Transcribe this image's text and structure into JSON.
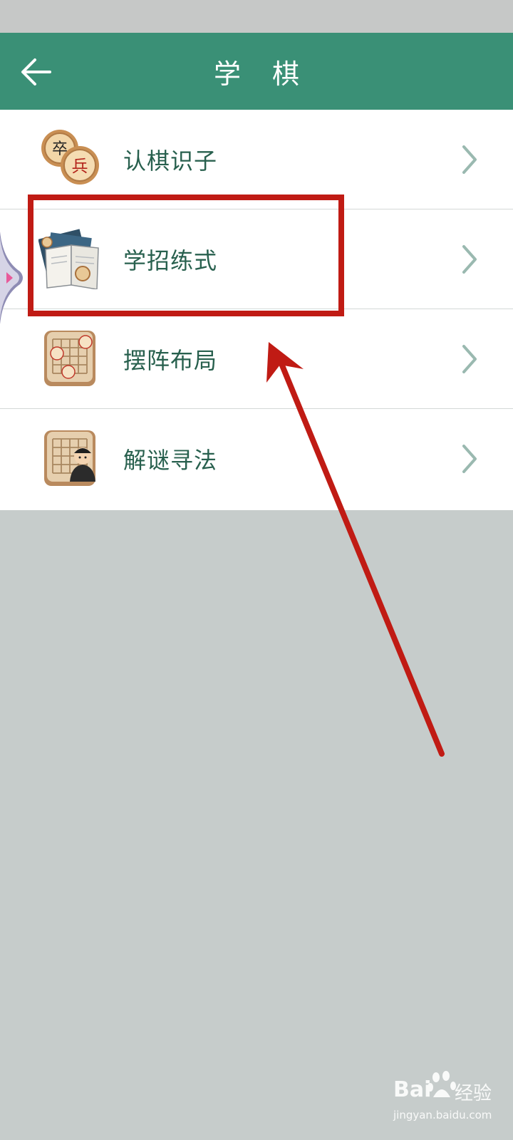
{
  "header": {
    "title": "学 棋",
    "bg_color": "#3a9076"
  },
  "menu": {
    "items": [
      {
        "label": "认棋识子",
        "icon": "chess-pieces-icon"
      },
      {
        "label": "学招练式",
        "icon": "chess-book-icon"
      },
      {
        "label": "摆阵布局",
        "icon": "chess-board-layout-icon"
      },
      {
        "label": "解谜寻法",
        "icon": "chess-puzzle-icon"
      }
    ],
    "label_color": "#28604e"
  },
  "annotation": {
    "color": "#c01b14"
  },
  "watermark": {
    "brand": "Bai",
    "brand_cn": "经验",
    "url": "jingyan.baidu.com"
  }
}
